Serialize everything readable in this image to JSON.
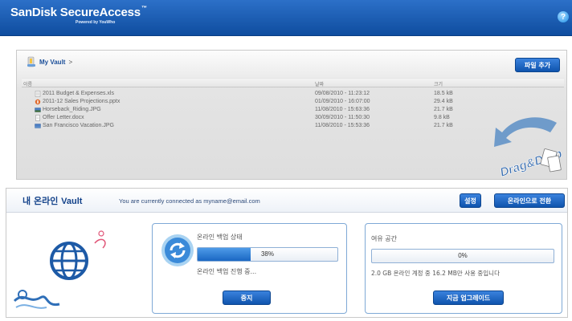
{
  "app": {
    "brand_name": "SanDisk SecureAccess",
    "brand_tm": "™",
    "powered_by": "Powered by YouWho",
    "help_glyph": "?"
  },
  "vault": {
    "breadcrumb_root": "My Vault",
    "breadcrumb_sep": ">",
    "add_file_label": "파일 추가",
    "columns": {
      "name": "이름",
      "date": "날짜",
      "size": "크기"
    },
    "files": [
      {
        "name": "2011 Budget & Expenses.xls",
        "date": "09/08/2010 - 11:23:12",
        "size": "18.5 kB",
        "icon": "spreadsheet-file-icon"
      },
      {
        "name": "2011-12 Sales Projections.pptx",
        "date": "01/09/2010 - 16:07:00",
        "size": "29.4 kB",
        "icon": "presentation-file-icon"
      },
      {
        "name": "Horseback_Riding.JPG",
        "date": "11/08/2010 - 15:63:36",
        "size": "21.7 kB",
        "icon": "image-file-icon"
      },
      {
        "name": "Offer Letter.docx",
        "date": "30/09/2010 - 11:50:30",
        "size": "9.8 kB",
        "icon": "document-file-icon"
      },
      {
        "name": "San Francisco Vacation.JPG",
        "date": "11/08/2010 - 15:53:36",
        "size": "21.7 kB",
        "icon": "image-file-icon"
      }
    ],
    "drag_drop_text": "Drag&Drop"
  },
  "online": {
    "title_ko": "내 온라인",
    "title_en": "Vault",
    "connection_status": "You are currently connected as myname@email.com",
    "settings_label": "설정",
    "go_online_label": "온라인으로 전환",
    "backup": {
      "status_label": "온라인 백업 상태",
      "progress_text": "38%",
      "progress_fraction": 0.38,
      "status_detail": "온라인 백업 진행 중...",
      "stop_label": "중지"
    },
    "space": {
      "label": "여유 공간",
      "progress_text": "0%",
      "progress_fraction": 0.0,
      "usage_text": "2.0 GB 온라인 계정 중 16.2 MB만 사용 중입니다",
      "upgrade_label": "지금 업그레이드"
    }
  },
  "colors": {
    "header_blue": "#1a5db3",
    "accent_blue": "#1560b8",
    "title_navy": "#13428a"
  }
}
